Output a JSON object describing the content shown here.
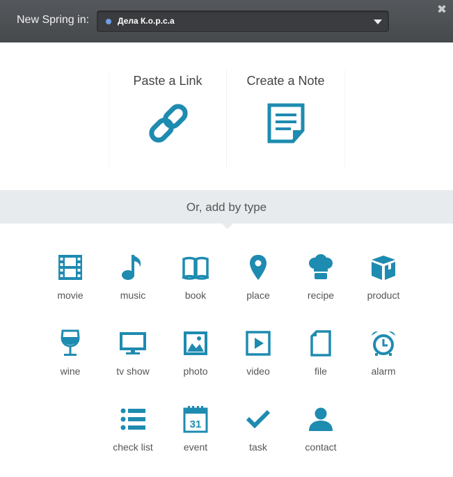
{
  "header": {
    "label": "New Spring in:",
    "dropdown_value": "Дела К.о.р.с.а",
    "close_glyph": "✖"
  },
  "actions": [
    {
      "label": "Paste a Link",
      "icon": "link-icon"
    },
    {
      "label": "Create a Note",
      "icon": "note-icon"
    }
  ],
  "type_section": {
    "heading": "Or, add by type"
  },
  "types": [
    {
      "label": "movie",
      "icon": "film-icon"
    },
    {
      "label": "music",
      "icon": "music-note-icon"
    },
    {
      "label": "book",
      "icon": "open-book-icon"
    },
    {
      "label": "place",
      "icon": "map-pin-icon"
    },
    {
      "label": "recipe",
      "icon": "chef-hat-icon"
    },
    {
      "label": "product",
      "icon": "box-icon"
    },
    {
      "label": "wine",
      "icon": "wine-glass-icon"
    },
    {
      "label": "tv show",
      "icon": "tv-icon"
    },
    {
      "label": "photo",
      "icon": "picture-icon"
    },
    {
      "label": "video",
      "icon": "play-video-icon"
    },
    {
      "label": "file",
      "icon": "file-icon"
    },
    {
      "label": "alarm",
      "icon": "alarm-clock-icon"
    },
    {
      "label": "check list",
      "icon": "checklist-icon"
    },
    {
      "label": "event",
      "icon": "calendar-icon",
      "day": "31"
    },
    {
      "label": "task",
      "icon": "checkmark-icon"
    },
    {
      "label": "contact",
      "icon": "person-icon"
    }
  ],
  "colors": {
    "accent": "#1e8bb0",
    "header_bg": "#4e5154",
    "type_bar_bg": "#e8ebed"
  }
}
